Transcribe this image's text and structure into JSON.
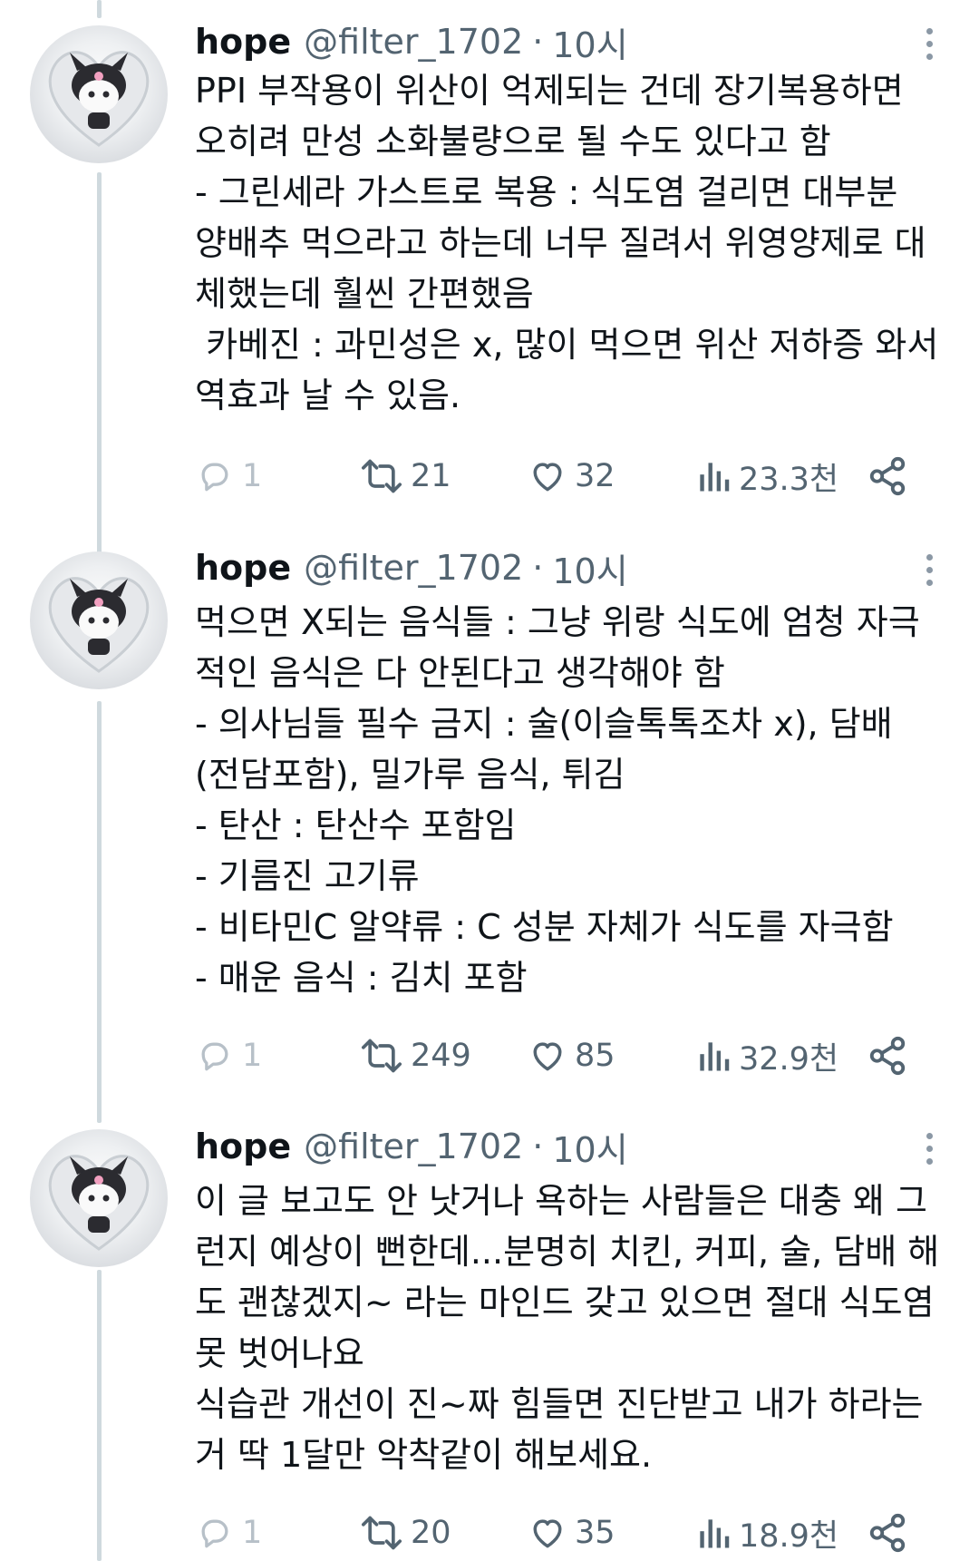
{
  "tweets": [
    {
      "author": {
        "name": "hope",
        "handle": "@filter_1702",
        "separator": "·",
        "time": "10시"
      },
      "lines": [
        "PPI 부작용이 위산이 억제되는 건데 장기복용하면",
        "오히려 만성 소화불량으로 될 수도 있다고 함",
        "- 그린세라 가스트로 복용 : 식도염 걸리면 대부분",
        "양배추 먹으라고 하는데 너무 질려서 위영양제로 대",
        "체했는데 훨씬 간편했음",
        " 카베진 : 과민성은 x, 많이 먹으면 위산 저하증 와서",
        "역효과 날 수 있음."
      ],
      "stats": {
        "replies": "1",
        "retweets": "21",
        "likes": "32",
        "views": "23.3천"
      }
    },
    {
      "author": {
        "name": "hope",
        "handle": "@filter_1702",
        "separator": "·",
        "time": "10시"
      },
      "lines": [
        "먹으면 X되는 음식들 : 그냥 위랑 식도에 엄청 자극",
        "적인 음식은 다 안된다고 생각해야 함",
        "- 의사님들 필수 금지 : 술(이슬톡톡조차 x), 담배",
        "(전담포함), 밀가루 음식, 튀김",
        "- 탄산 : 탄산수 포함임",
        "- 기름진 고기류",
        "- 비타민C 알약류 : C 성분 자체가 식도를 자극함",
        "- 매운 음식 : 김치 포함"
      ],
      "stats": {
        "replies": "1",
        "retweets": "249",
        "likes": "85",
        "views": "32.9천"
      }
    },
    {
      "author": {
        "name": "hope",
        "handle": "@filter_1702",
        "separator": "·",
        "time": "10시"
      },
      "lines": [
        "이 글 보고도 안 낫거나 욕하는 사람들은 대충 왜 그",
        "런지 예상이 뻔한데...분명히 치킨, 커피, 술, 담배 해",
        "도 괜찮겠지~ 라는 마인드 갖고 있으면 절대 식도염",
        "못 벗어나요",
        "식습관 개선이 진~짜 힘들면 진단받고 내가 하라는",
        "거 딱 1달만 악착같이 해보세요."
      ],
      "stats": {
        "replies": "1",
        "retweets": "20",
        "likes": "35",
        "views": "18.9천"
      }
    }
  ],
  "icons": {
    "reply": "reply-icon",
    "retweet": "retweet-icon",
    "like": "heart-icon",
    "views": "views-icon",
    "share": "share-icon",
    "more": "more-icon"
  },
  "colors": {
    "text": "#0f1419",
    "secondary": "#536471",
    "thread_line": "#cfd9de"
  }
}
